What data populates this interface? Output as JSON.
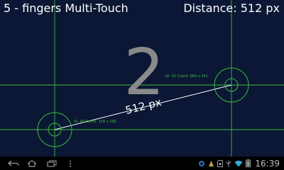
{
  "app": {
    "title": "5 - fingers Multi-Touch",
    "distance_label": "Distance: 512 px",
    "touch_count": "2",
    "line_distance_label": "512 px",
    "touches": [
      {
        "id_label": "ID: 00 Coord: 156 x 366"
      },
      {
        "id_label": "ID: 01 Coord: 664 x 241"
      }
    ],
    "colors": {
      "background": "#0b1734",
      "guide": "#3dbb3d",
      "count": "#8a8a8a",
      "text": "#ffffff"
    }
  },
  "navbar": {
    "buttons": [
      "back-icon",
      "home-icon",
      "recent-apps-icon",
      "menu-icon"
    ]
  },
  "status": {
    "icons": [
      "app-notification-icon",
      "notification-icon",
      "sd-card-icon",
      "usb-icon",
      "wifi-icon",
      "battery-icon"
    ],
    "time": "16:39"
  }
}
